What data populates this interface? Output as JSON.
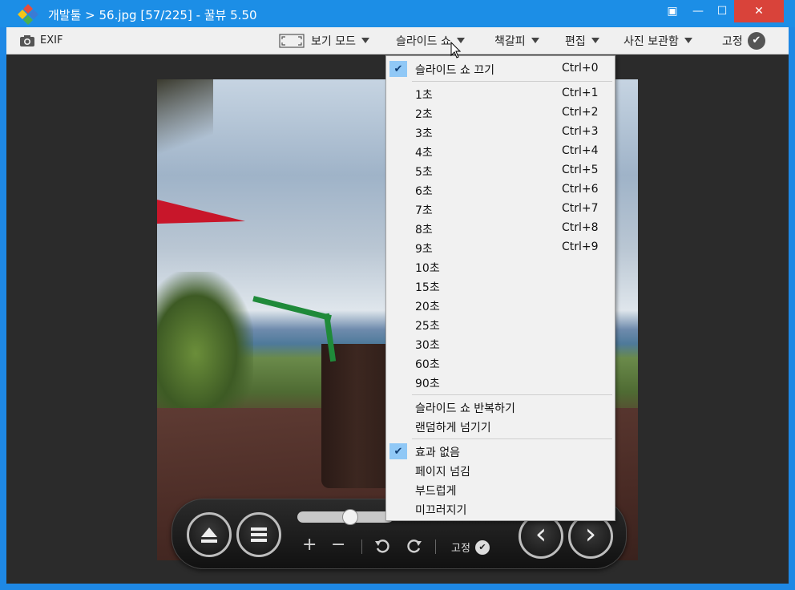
{
  "window": {
    "title": "개발툴 > 56.jpg [57/225] - 꿀뷰 5.50",
    "controls": {
      "minimize": "—",
      "maximize": "☐",
      "close": "✕",
      "mini": "▣"
    }
  },
  "toolbar": {
    "exif": "EXIF",
    "view_mode": "보기 모드",
    "slideshow": "슬라이드 쇼",
    "bookmark": "책갈피",
    "edit": "편집",
    "photo_archive": "사진 보관함",
    "pin": "고정"
  },
  "menu": {
    "stop": {
      "label": "슬라이드 쇼 끄기",
      "shortcut": "Ctrl+0",
      "checked": true
    },
    "intervals": [
      {
        "label": "1초",
        "shortcut": "Ctrl+1"
      },
      {
        "label": "2초",
        "shortcut": "Ctrl+2"
      },
      {
        "label": "3초",
        "shortcut": "Ctrl+3"
      },
      {
        "label": "4초",
        "shortcut": "Ctrl+4"
      },
      {
        "label": "5초",
        "shortcut": "Ctrl+5"
      },
      {
        "label": "6초",
        "shortcut": "Ctrl+6"
      },
      {
        "label": "7초",
        "shortcut": "Ctrl+7"
      },
      {
        "label": "8초",
        "shortcut": "Ctrl+8"
      },
      {
        "label": "9초",
        "shortcut": "Ctrl+9"
      },
      {
        "label": "10초",
        "shortcut": ""
      },
      {
        "label": "15초",
        "shortcut": ""
      },
      {
        "label": "20초",
        "shortcut": ""
      },
      {
        "label": "25초",
        "shortcut": ""
      },
      {
        "label": "30초",
        "shortcut": ""
      },
      {
        "label": "60초",
        "shortcut": ""
      },
      {
        "label": "90초",
        "shortcut": ""
      }
    ],
    "repeat": "슬라이드 쇼 반복하기",
    "random": "랜덤하게 넘기기",
    "effects": [
      {
        "label": "효과 없음",
        "checked": true
      },
      {
        "label": "페이지 넘김",
        "checked": false
      },
      {
        "label": "부드럽게",
        "checked": false
      },
      {
        "label": "미끄러지기",
        "checked": false
      }
    ]
  },
  "controls": {
    "pin": "고정",
    "zoom_in": "+",
    "zoom_out": "−",
    "prev": "‹",
    "next": "›"
  }
}
